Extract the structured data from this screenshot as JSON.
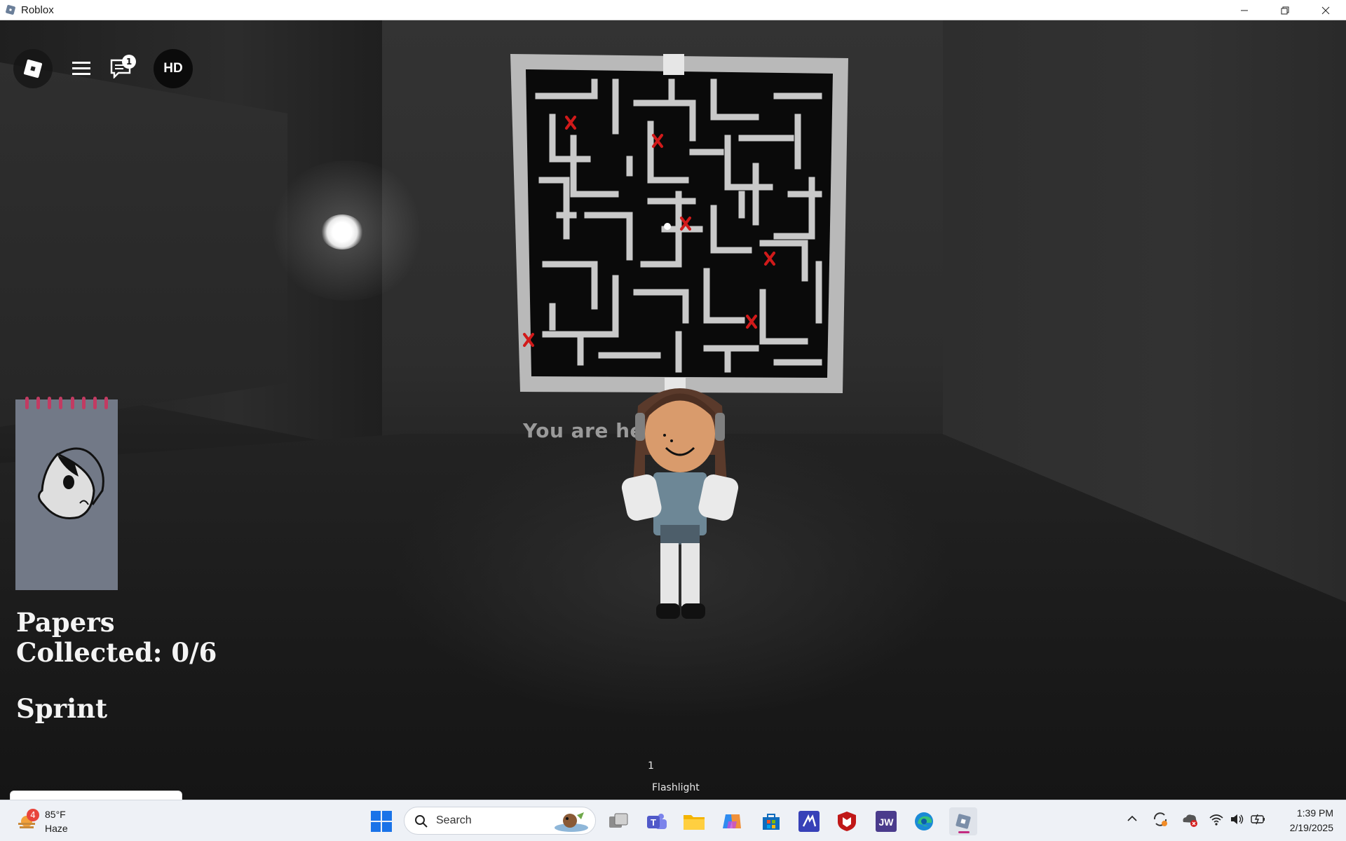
{
  "window": {
    "title": "Roblox",
    "controls": [
      "minimize",
      "restore",
      "close"
    ]
  },
  "hud": {
    "chat_badge_count": "1",
    "avatar_initials": "HD"
  },
  "scene": {
    "map_caption": "You are her",
    "map_markers": 6
  },
  "game_ui": {
    "papers_line1": "Papers",
    "papers_line2": "Collected: 0/6",
    "sprint_label": "Sprint",
    "sprint_level": 1.0,
    "hotbar_slot": "1",
    "hotbar_item": "Flashlight"
  },
  "taskbar": {
    "weather_badge": "4",
    "weather_temp": "85°F",
    "weather_condition": "Haze",
    "search_placeholder": "Search",
    "apps": [
      "start-icon",
      "task-view-icon",
      "teams-icon",
      "file-explorer-icon",
      "copilot-icon",
      "microsoft-store-icon",
      "jw-app-icon-1",
      "mcafee-icon",
      "jw-app-icon-2",
      "edge-icon",
      "roblox-icon"
    ],
    "clock_time": "1:39 PM",
    "clock_date": "2/19/2025"
  },
  "colors": {
    "notepad": "#727987",
    "notepad_rings": "#c23b62",
    "map_marker": "#d11a1a",
    "taskbar_bg": "#eef1f6",
    "active_app_indicator": "#c32b80"
  }
}
